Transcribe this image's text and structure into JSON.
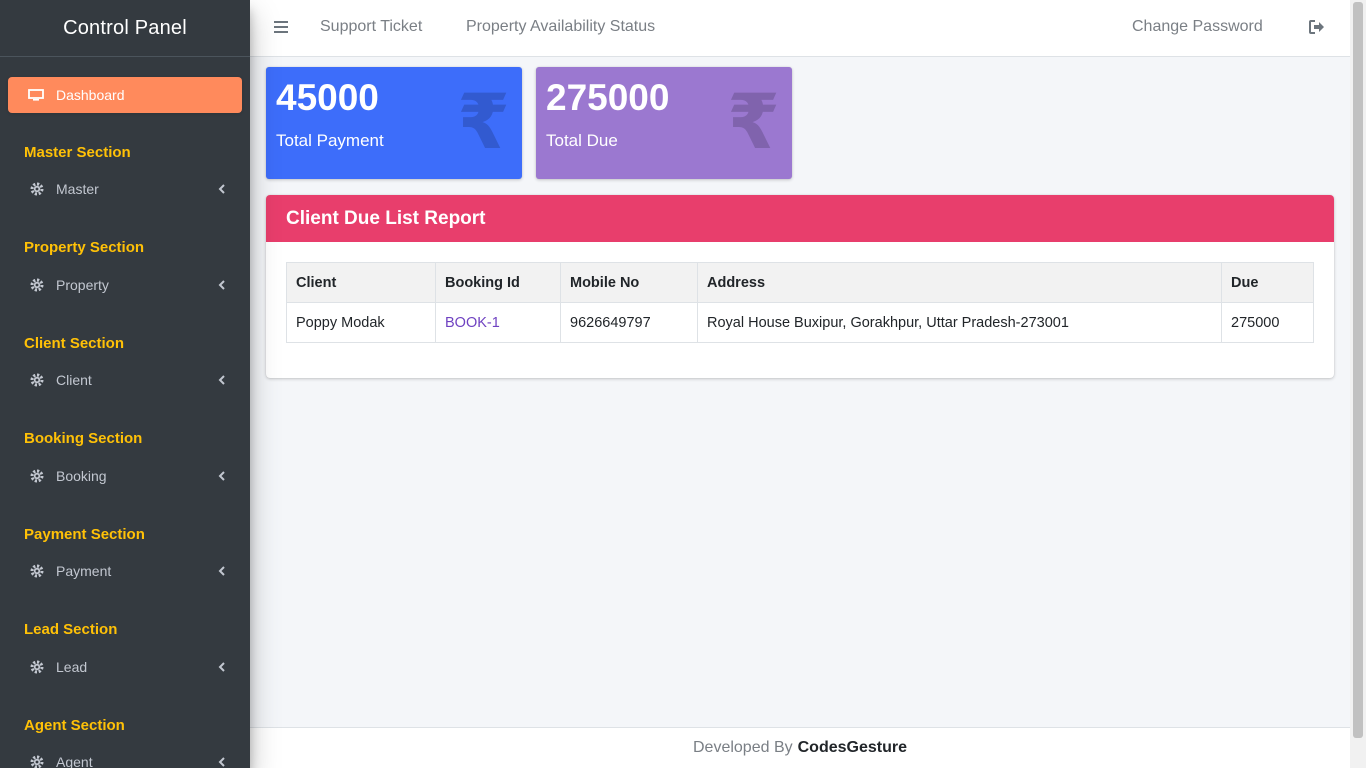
{
  "sidebar": {
    "brand": "Control Panel",
    "active": "Dashboard",
    "sections": [
      {
        "title": "Master Section",
        "item": "Master"
      },
      {
        "title": "Property Section",
        "item": "Property"
      },
      {
        "title": "Client Section",
        "item": "Client"
      },
      {
        "title": "Booking Section",
        "item": "Booking"
      },
      {
        "title": "Payment Section",
        "item": "Payment"
      },
      {
        "title": "Lead Section",
        "item": "Lead"
      },
      {
        "title": "Agent Section",
        "item": "Agent"
      }
    ]
  },
  "topnav": {
    "support": "Support Ticket",
    "availability": "Property Availability Status",
    "change_password": "Change Password"
  },
  "stats": [
    {
      "value": "45000",
      "label": "Total Payment",
      "color": "#3d6dfa"
    },
    {
      "value": "275000",
      "label": "Total Due",
      "color": "#9b78d0"
    }
  ],
  "report": {
    "title": "Client Due List Report",
    "headers": [
      "Client",
      "Booking Id",
      "Mobile No",
      "Address",
      "Due"
    ],
    "rows": [
      [
        "Poppy Modak",
        "BOOK-1",
        "9626649797",
        "Royal House Buxipur, Gorakhpur, Uttar Pradesh-273001",
        "275000"
      ]
    ]
  },
  "footer": {
    "prefix": "Developed By",
    "brand": "CodesGesture"
  }
}
